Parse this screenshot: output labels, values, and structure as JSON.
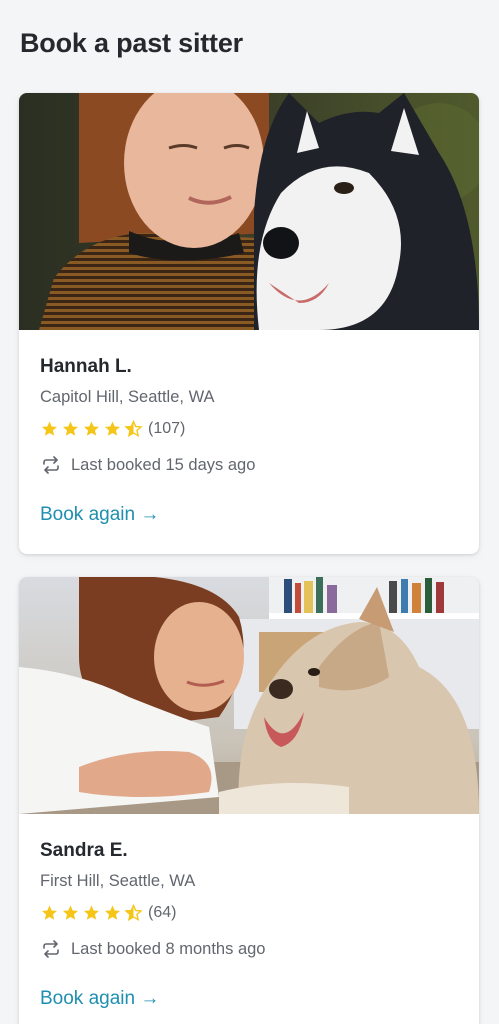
{
  "page": {
    "title": "Book a past sitter"
  },
  "colors": {
    "link": "#1f8fb0",
    "star": "#f5c518",
    "secondary_text": "#62666d",
    "background": "#f4f5f7"
  },
  "sitters": [
    {
      "name": "Hannah L.",
      "location": "Capitol Hill, Seattle, WA",
      "rating": 4.5,
      "review_count": "(107)",
      "last_booked": "Last booked 15 days ago",
      "cta": "Book again →",
      "photo_description": "woman-with-husky"
    },
    {
      "name": "Sandra E.",
      "location": "First Hill, Seattle, WA",
      "rating": 4.5,
      "review_count": "(64)",
      "last_booked": "Last booked 8 months ago",
      "cta": "Book again →",
      "photo_description": "woman-with-fluffy-dog"
    }
  ],
  "icons": {
    "star": "star-icon",
    "half_star": "half-star-icon",
    "repeat": "repeat-icon"
  }
}
